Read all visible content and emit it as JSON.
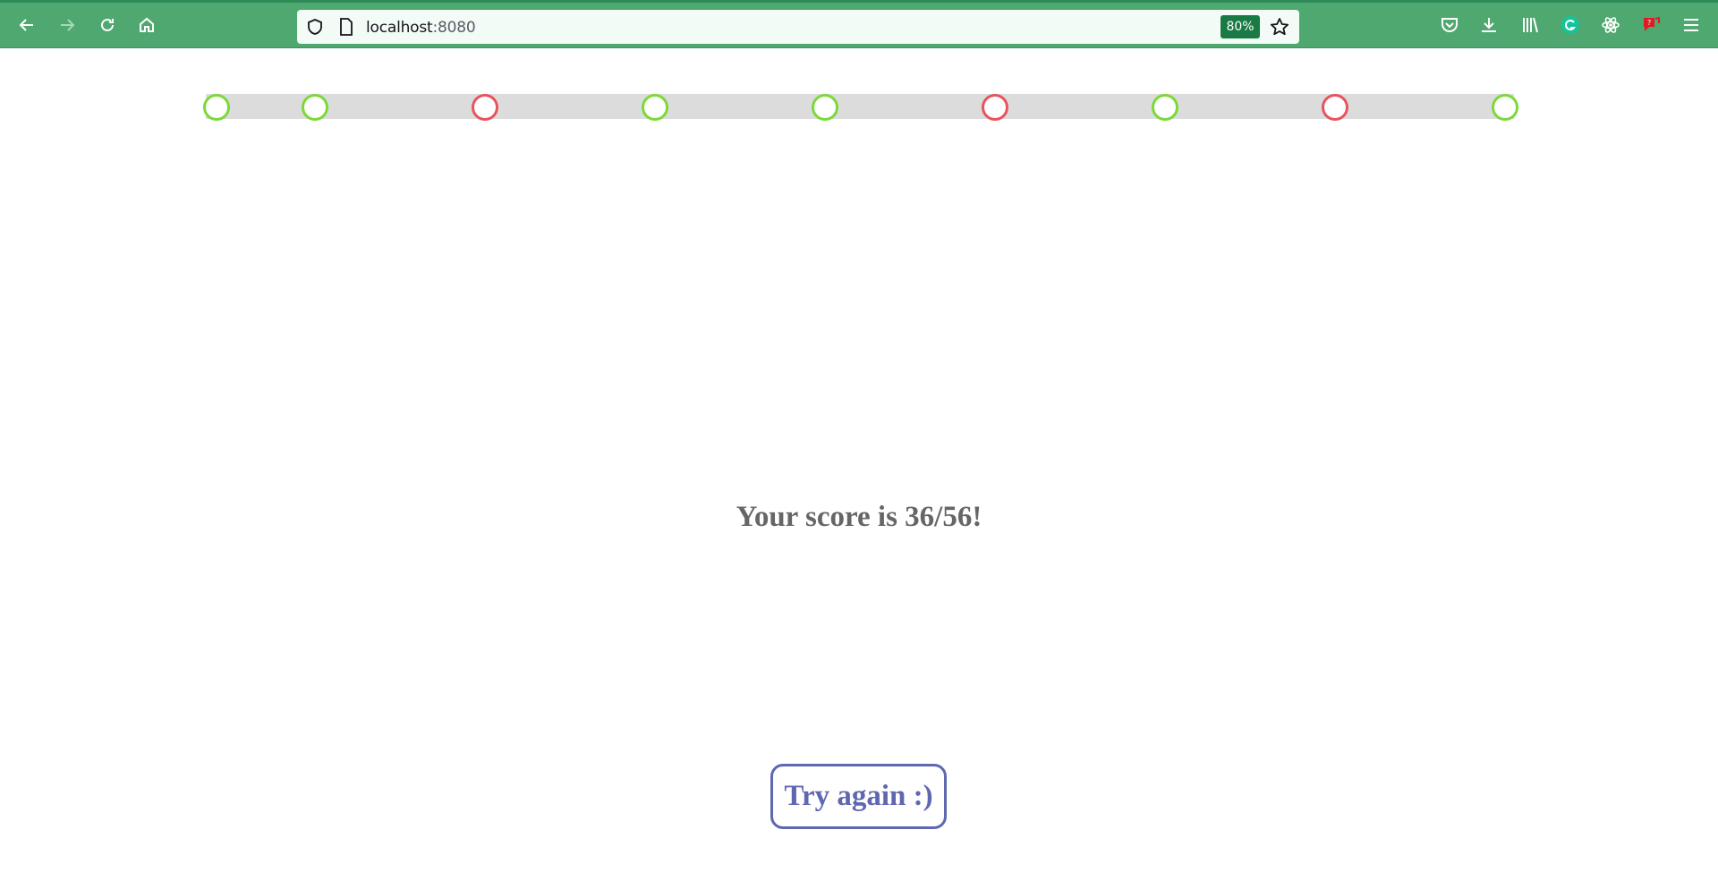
{
  "browser": {
    "url_host": "localhost",
    "url_port": ":8080",
    "zoom": "80%",
    "icons": [
      "back-icon",
      "forward-icon",
      "reload-icon",
      "home-icon",
      "shield-icon",
      "page-icon",
      "star-icon",
      "pocket-icon",
      "download-icon",
      "library-icon",
      "grammarly-icon",
      "react-devtools-icon",
      "extension-icon",
      "menu-icon"
    ]
  },
  "progress": {
    "results": [
      "correct",
      "correct",
      "wrong",
      "correct",
      "correct",
      "wrong",
      "correct",
      "wrong",
      "correct"
    ]
  },
  "main": {
    "score_text": "Your score is 36/56!",
    "try_again_label": "Try again :)"
  },
  "colors": {
    "correct": "#7cd938",
    "wrong": "#e9535d",
    "button": "#5e67b0",
    "score_text": "#666666",
    "toolbar": "#4fa86f"
  }
}
